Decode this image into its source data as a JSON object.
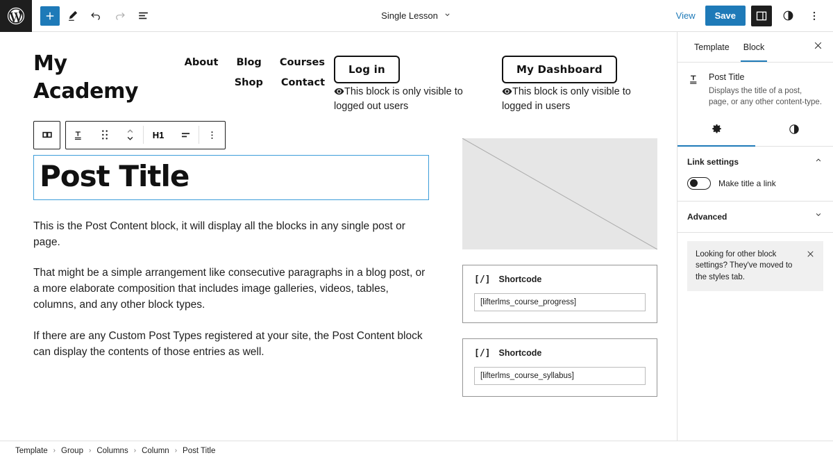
{
  "topbar": {
    "logo_icon": "wordpress-logo-icon",
    "tools": [
      {
        "name": "add-block-button",
        "icon": "plus-icon"
      },
      {
        "name": "edit-tool-button",
        "icon": "pencil-icon"
      },
      {
        "name": "undo-button",
        "icon": "undo-arrow-icon"
      },
      {
        "name": "redo-button",
        "icon": "redo-arrow-icon"
      },
      {
        "name": "list-view-button",
        "icon": "list-view-icon"
      }
    ],
    "document_title": "Single Lesson",
    "document_chevron_icon": "chevron-down-icon",
    "view_label": "View",
    "save_label": "Save",
    "settings_sidebar_icon": "sidebar-panel-icon",
    "styles_icon": "half-circle-contrast-icon",
    "more_menu_icon": "three-dots-vertical-icon"
  },
  "site": {
    "title_line1": "My",
    "title_line2": "Academy",
    "nav_row1": [
      "About",
      "Blog",
      "Courses"
    ],
    "nav_row2": [
      "Shop",
      "Contact"
    ],
    "login_button": "Log in",
    "login_visibility_note": "This block is only visible to logged out users",
    "dashboard_button": "My  Dashboard",
    "dashboard_visibility_note": "This block is only visible to logged in users",
    "eye_icon": "eye-visibility-icon"
  },
  "block_toolbar": {
    "column_layout_icon": "columns-layout-icon",
    "block_type_icon": "post-title-T-icon",
    "drag_icon": "drag-handle-dots-icon",
    "move_icon": "move-up-down-chevrons-icon",
    "heading_level": "H1",
    "align_icon": "text-align-icon",
    "options_icon": "three-dots-vertical-icon"
  },
  "editor": {
    "post_title": "Post Title",
    "paragraphs": [
      "This is the Post Content block, it will display all the blocks in any single post or page.",
      "That might be a simple arrangement like consecutive paragraphs in a blog post, or a more elaborate composition that includes image galleries, videos, tables, columns, and any other block types.",
      "If there are any Custom Post Types registered at your site, the Post Content block can display the contents of those entries as well."
    ],
    "image_placeholder_name": "featured-image-placeholder",
    "shortcodes": [
      {
        "icon": "[/]",
        "label": "Shortcode",
        "value": "[lifterlms_course_progress]"
      },
      {
        "icon": "[/]",
        "label": "Shortcode",
        "value": "[lifterlms_course_syllabus]"
      }
    ]
  },
  "sidebar": {
    "tabs": [
      {
        "label": "Template",
        "active": false
      },
      {
        "label": "Block",
        "active": true
      }
    ],
    "close_icon": "close-x-icon",
    "block": {
      "icon": "post-title-T-icon",
      "name": "Post Title",
      "description": "Displays the title of a post, page, or any other content-type."
    },
    "inner_tabs": [
      {
        "name": "settings-tab",
        "icon": "gear-icon",
        "active": true
      },
      {
        "name": "styles-tab",
        "icon": "half-circle-contrast-icon",
        "active": false
      }
    ],
    "panels": [
      {
        "title": "Link settings",
        "expanded": true,
        "chevron_icon": "chevron-up-icon"
      },
      {
        "title": "Advanced",
        "expanded": false,
        "chevron_icon": "chevron-down-icon"
      }
    ],
    "link_toggle_label": "Make title a link",
    "link_toggle_on": false,
    "notice_text": "Looking for other block settings? They've moved to the styles tab.",
    "notice_close_icon": "close-x-icon"
  },
  "footer": {
    "breadcrumbs": [
      "Template",
      "Group",
      "Columns",
      "Column",
      "Post Title"
    ],
    "separator": "›"
  },
  "colors": {
    "accent_blue": "#1e7ab8",
    "selection_blue": "#3b9cd9",
    "ink": "#1e1e1e",
    "placeholder_grey": "#e6e6e6"
  }
}
